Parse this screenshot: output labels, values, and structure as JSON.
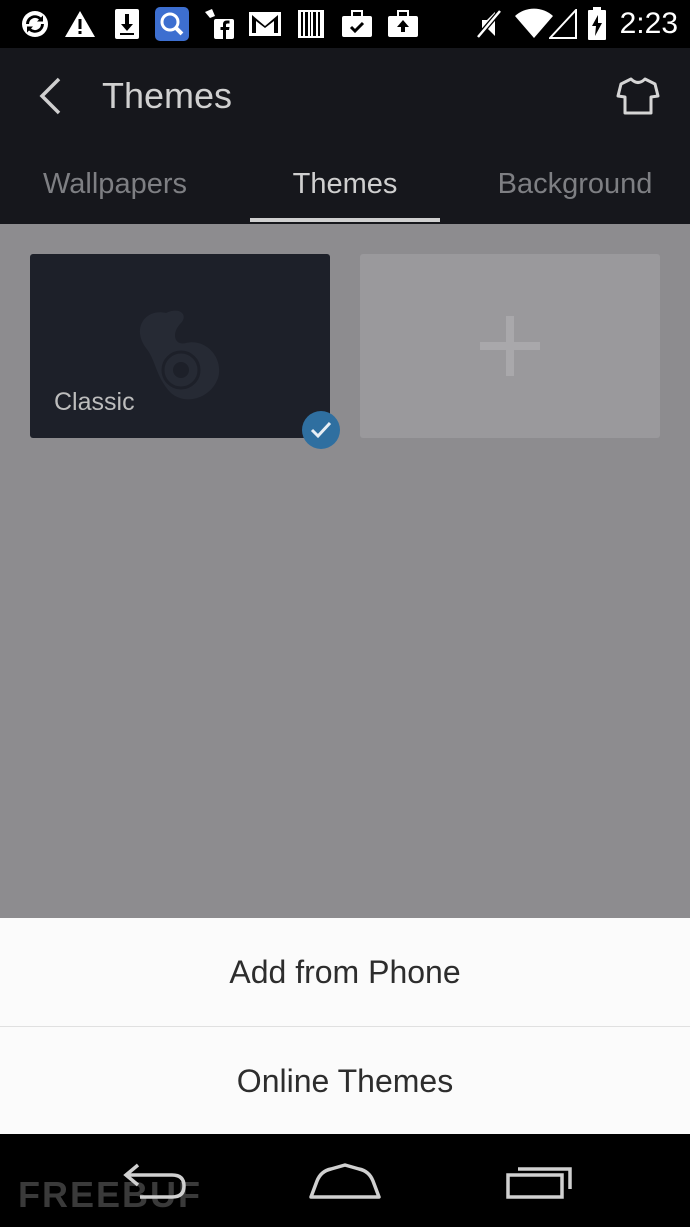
{
  "status_bar": {
    "time": "2:23",
    "icons": [
      "sync-icon",
      "warning-icon",
      "download-icon",
      "search-app-icon",
      "facebook-icon",
      "gmail-icon",
      "barcode-icon",
      "briefcase-icon",
      "briefcase-upload-icon",
      "mute-icon",
      "wifi-icon",
      "signal-icon",
      "battery-icon"
    ]
  },
  "app_bar": {
    "title": "Themes",
    "back_icon": "back-arrow-icon",
    "right_icon": "shirt-icon"
  },
  "tabs": [
    {
      "label": "Wallpapers",
      "active": false
    },
    {
      "label": "Themes",
      "active": true
    },
    {
      "label": "Background",
      "active": false
    }
  ],
  "themes": [
    {
      "label": "Classic",
      "selected": true
    }
  ],
  "add_tile_icon": "plus-icon",
  "sheet": {
    "items": [
      "Add from Phone",
      "Online Themes"
    ]
  },
  "nav_bar": {
    "icons": [
      "back-icon",
      "home-icon",
      "recent-apps-icon"
    ]
  },
  "watermark": "FREEBUF",
  "colors": {
    "accent": "#2f6fa0",
    "app_bar": "#16171c",
    "scrim_background": "#8d8c8f",
    "sheet": "#fbfbfb"
  }
}
